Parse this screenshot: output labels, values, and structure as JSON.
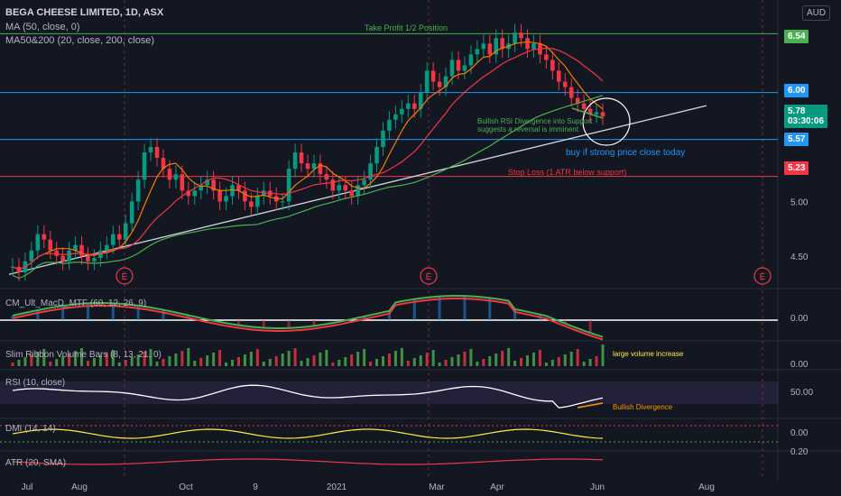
{
  "header": {
    "title": "BEGA CHEESE LIMITED, 1D, ASX",
    "indicators": [
      "MA (50, close, 0)",
      "MA50&200 (20, close, 200, close)"
    ],
    "currency_button": "AUD"
  },
  "chart_data": {
    "type": "candlestick",
    "price_axis": {
      "ticks": [
        4.5,
        5.0,
        5.23,
        5.57,
        6.0,
        6.54
      ],
      "ylim": [
        4.2,
        6.85
      ]
    },
    "x_axis": {
      "labels": [
        "Jul",
        "Aug",
        "Oct",
        "9",
        "2021",
        "Mar",
        "Apr",
        "Jun",
        "Aug"
      ]
    },
    "levels": [
      {
        "label": "Take Profit 1/2 Position",
        "value": 6.54,
        "tag": "6.54",
        "color": "#4caf50"
      },
      {
        "label": "",
        "value": 6.0,
        "tag": "6.00",
        "color": "#2196f3"
      },
      {
        "label": "",
        "value": 5.57,
        "tag": "5.57",
        "color": "#2196f3"
      },
      {
        "label": "Stop Loss (1 ATR below support)",
        "value": 5.23,
        "tag": "5.23",
        "color": "#f23645"
      }
    ],
    "last_price": {
      "value": "5.78",
      "countdown": "03:30:06",
      "color": "#089981"
    },
    "annotations": [
      "Bullish RSI Divergence into Support",
      "suggests a reversal is imminent",
      "buy if strong price close today",
      "large volume increase",
      "Bullish Divergence"
    ],
    "earnings_markers": [
      "E",
      "E",
      "E"
    ],
    "close_series": [
      4.4,
      4.35,
      4.45,
      4.55,
      4.7,
      4.65,
      4.55,
      4.5,
      4.45,
      4.55,
      4.6,
      4.5,
      4.45,
      4.48,
      4.55,
      4.6,
      4.7,
      4.65,
      4.8,
      5.0,
      5.2,
      5.45,
      5.5,
      5.4,
      5.3,
      5.2,
      5.25,
      5.1,
      5.05,
      5.1,
      5.15,
      5.2,
      5.1,
      5.0,
      5.05,
      5.15,
      5.1,
      5.0,
      4.95,
      5.05,
      5.1,
      5.05,
      5.0,
      5.0,
      5.3,
      5.45,
      5.35,
      5.3,
      5.35,
      5.25,
      5.2,
      5.1,
      5.15,
      5.1,
      5.05,
      5.15,
      5.2,
      5.35,
      5.5,
      5.65,
      5.75,
      5.8,
      5.85,
      5.9,
      5.85,
      6.0,
      6.2,
      6.1,
      6.05,
      6.15,
      6.3,
      6.2,
      6.25,
      6.35,
      6.4,
      6.45,
      6.35,
      6.5,
      6.4,
      6.45,
      6.55,
      6.5,
      6.4,
      6.45,
      6.35,
      6.3,
      6.2,
      6.1,
      6.05,
      5.95,
      5.9,
      5.85,
      5.8,
      5.82,
      5.78
    ],
    "sub_panels": [
      {
        "name": "CM_Ult_MacD_MTF (60, 12, 26, 9)",
        "value": "0.00"
      },
      {
        "name": "Slim Ribbon Volume Bars (8, 13, 21, 0)",
        "value": "0.00"
      },
      {
        "name": "RSI (10, close)",
        "value": "50.00"
      },
      {
        "name": "DMI (14, 14)",
        "value": "0.00"
      },
      {
        "name": "ATR (20, SMA)",
        "value": "0.20"
      }
    ]
  },
  "colors": {
    "up": "#089981",
    "down": "#f23645",
    "bg": "#131722"
  }
}
